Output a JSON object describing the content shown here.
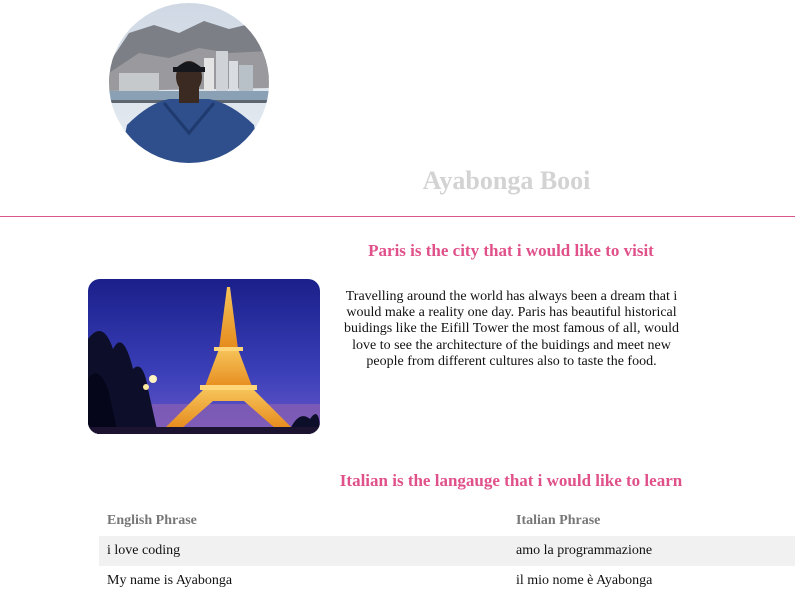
{
  "profile": {
    "name": "Ayabonga Booi"
  },
  "paris": {
    "heading": "Paris is the city that i would like to visit",
    "text": "Travelling around the world has always been a dream that i would make a reality one day. Paris has beautiful historical buidings like the Eifill Tower the most famous of all, would love to see the architecture of the buidings and meet new people from different cultures also to taste the food."
  },
  "italian": {
    "heading": "Italian is the langauge that i would like to learn",
    "columns": [
      "English Phrase",
      "Italian Phrase"
    ],
    "rows": [
      {
        "english": "i love coding",
        "italian": "amo la programmazione"
      },
      {
        "english": "My name is Ayabonga",
        "italian": "il mio nome è Ayabonga"
      }
    ]
  },
  "colors": {
    "accent": "#e0518a",
    "name": "#d3d3d3",
    "row_shade": "#f1f1f1"
  }
}
